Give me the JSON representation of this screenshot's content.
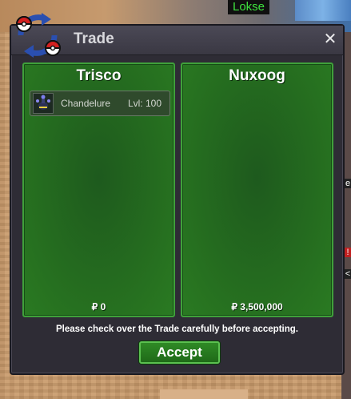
{
  "world": {
    "player_name": "Lokse",
    "side_fragments": [
      "e",
      "!",
      "<"
    ]
  },
  "window": {
    "title": "Trade",
    "close_symbol": "✕"
  },
  "trade": {
    "left": {
      "name": "Trisco",
      "items": [
        {
          "name": "Chandelure",
          "level": "Lvl: 100"
        }
      ],
      "money": "₽ 0"
    },
    "right": {
      "name": "Nuxoog",
      "items": [],
      "money": "₽ 3,500,000"
    },
    "notice": "Please check over the Trade carefully before accepting.",
    "accept_label": "Accept"
  },
  "colors": {
    "panel_green": "#256d1f",
    "accent_green": "#3fa03a",
    "window_bg": "#2e2c35"
  },
  "icons": {
    "logo": "trade-swap-icon",
    "item": "chandelure-sprite-icon"
  }
}
